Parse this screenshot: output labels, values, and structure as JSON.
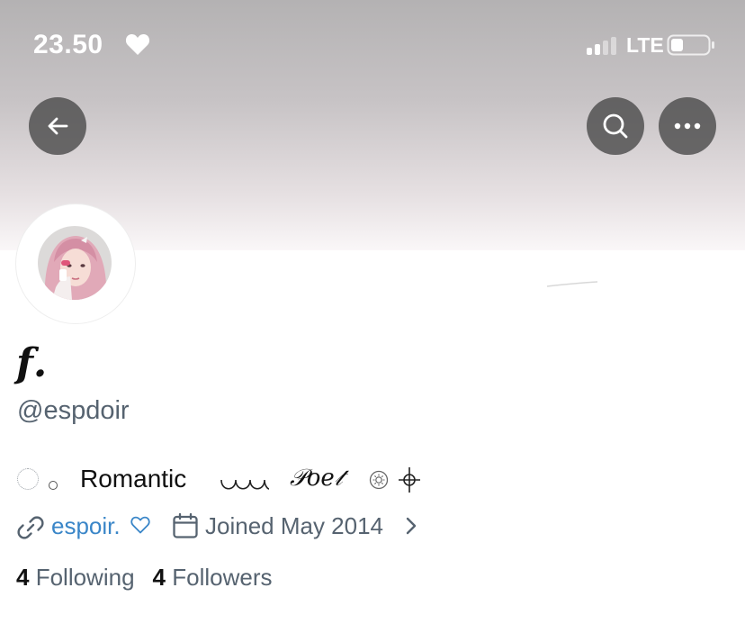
{
  "status_bar": {
    "time": "23.50",
    "network": "LTE",
    "time_icon": "heart-icon",
    "battery_level": 0.3
  },
  "navigation": {
    "back_icon": "arrow-left-icon",
    "search_icon": "search-icon",
    "more_icon": "more-horizontal-icon"
  },
  "profile": {
    "display_name": "𝒇.",
    "handle": "@espdoir",
    "bio": {
      "word_1": "Romantic",
      "word_2": "𝒫𝑜𝑒𝓉",
      "icons": [
        "dotted-circle-icon",
        "small-circle-icon",
        "wave-icon",
        "sun-icon",
        "crosshair-icon"
      ]
    },
    "website": "espoir.",
    "website_icon": "link-icon",
    "joined": "Joined May 2014",
    "joined_icon": "calendar-icon",
    "following_count": "4",
    "following_label": "Following",
    "followers_count": "4",
    "followers_label": "Followers"
  },
  "colors": {
    "link": "#3a86c8",
    "secondary_text": "#566370",
    "primary_text": "#111111",
    "nav_button": "#464646"
  }
}
